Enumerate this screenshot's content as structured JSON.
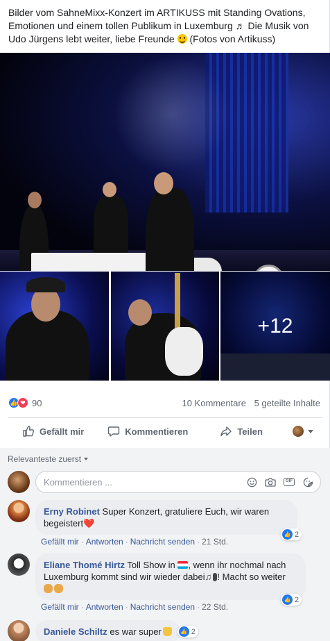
{
  "post": {
    "text": "Bilder vom SahneMixx-Konzert im ARTIKUSS mit Standing Ovations, Emotionen und einem tollen Publikum in Luxemburg ♬ Die Musik von Udo Jürgens lebt weiter, liebe Freunde",
    "text_suffix": "(Fotos von Artikuss)",
    "photos_more": "+12"
  },
  "reactions": {
    "count": "90",
    "comments": "10 Kommentare",
    "shares": "5 geteilte Inhalte"
  },
  "actions": {
    "like": "Gefällt mir",
    "comment": "Kommentieren",
    "share": "Teilen"
  },
  "comments_section": {
    "sort_label": "Relevanteste zuerst",
    "input_placeholder": "Kommentieren ...",
    "gif_label": "GIF",
    "items": [
      {
        "author": "Erny Robinet",
        "text": "Super Konzert, gratuliere Euch, wir waren begeistert",
        "like_label": "Gefällt mir",
        "reply_label": "Antworten",
        "message_label": "Nachricht senden",
        "time": "21 Std.",
        "likes": "2"
      },
      {
        "author": "Eliane Thomé Hirtz",
        "text_before_flag": "Toll Show in",
        "text_after_flag": ", wenn ihr nochmal nach Luxemburg kommt sind wir wieder dabei",
        "text_end": "! Macht so weiter",
        "like_label": "Gefällt mir",
        "reply_label": "Antworten",
        "message_label": "Nachricht senden",
        "time": "22 Std.",
        "likes": "2"
      },
      {
        "author": "Daniele Schiltz",
        "text": "es war super",
        "likes": "2"
      }
    ]
  },
  "colors": {
    "link": "#385898",
    "like_blue": "#2078f4",
    "love_red": "#f33e58",
    "comments_bg": "#f2f3f5"
  }
}
